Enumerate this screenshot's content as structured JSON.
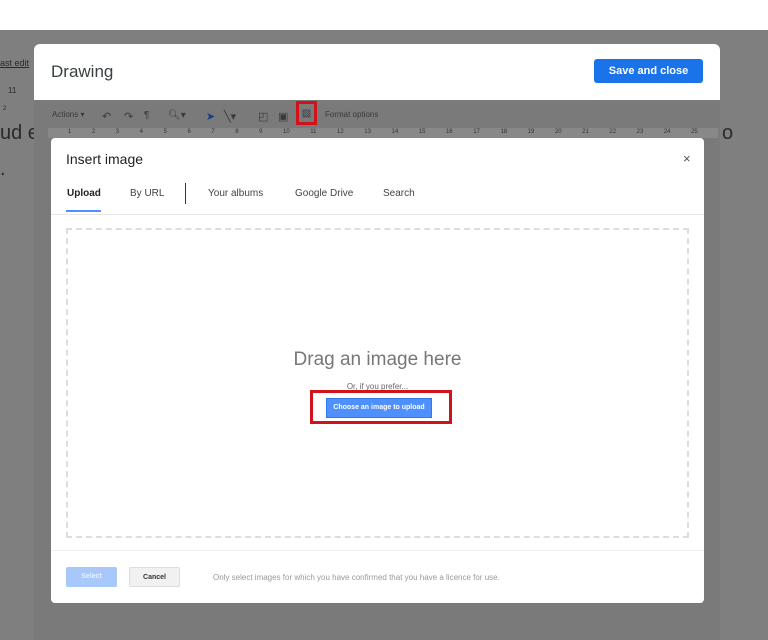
{
  "background_doc": {
    "last_edit": "ast edit",
    "font_size": "11",
    "ruler_num": "2",
    "text_fragment": "ud e",
    "text_dot": ".",
    "right_fragment": "o"
  },
  "drawing": {
    "title": "Drawing",
    "save_close": "Save and close",
    "toolbar": {
      "actions": "Actions ▾",
      "format_options": "Format options"
    },
    "ruler": [
      "1",
      "2",
      "3",
      "4",
      "5",
      "6",
      "7",
      "8",
      "9",
      "10",
      "11",
      "12",
      "13",
      "14",
      "15",
      "16",
      "17",
      "18",
      "19",
      "20",
      "21",
      "22",
      "23",
      "24",
      "25"
    ]
  },
  "insert_image": {
    "title": "Insert image",
    "close": "×",
    "tabs": [
      {
        "label": "Upload",
        "active": true
      },
      {
        "label": "By URL"
      },
      {
        "label": "Your albums"
      },
      {
        "label": "Google Drive"
      },
      {
        "label": "Search"
      }
    ],
    "drag_text": "Drag an image here",
    "prefer_text": "Or, if you prefer...",
    "choose_button": "Choose an image to upload",
    "select": "Select",
    "cancel": "Cancel",
    "licence_note": "Only select images for which you have confirmed that you have a licence for use."
  },
  "colors": {
    "accent": "#1a73e8",
    "highlight": "#d0121b"
  }
}
